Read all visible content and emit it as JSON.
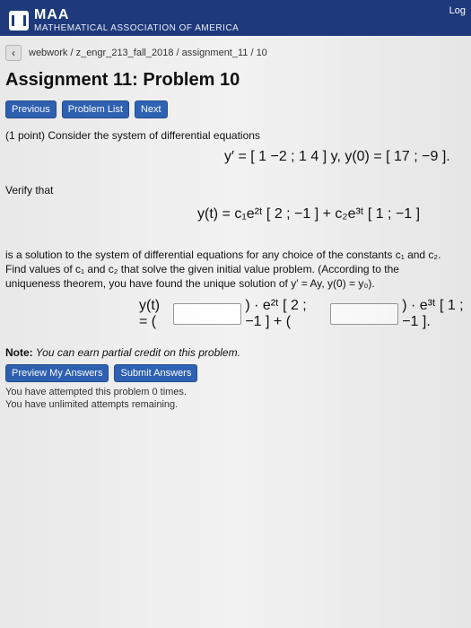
{
  "app": {
    "logo_text": "MAA",
    "logo_sub": "MATHEMATICAL ASSOCIATION OF AMERICA",
    "login": "Log"
  },
  "breadcrumb": {
    "path": "webwork / z_engr_213_fall_2018 / assignment_11 / 10"
  },
  "assignment": {
    "title": "Assignment 11: Problem 10",
    "nav": [
      "Previous",
      "Problem List",
      "Next"
    ]
  },
  "problem": {
    "intro": "(1 point) Consider the system of differential equations",
    "verify": "Verify that",
    "system_eq_text": "y′ = [ 1  −2 ; 1  4 ] y,  y(0) = [ 17 ; −9 ].",
    "general_sol_text": "y(t) = c₁e²ᵗ [ 2 ; −1 ] + c₂e³ᵗ [ 1 ; −1 ]",
    "explanation": "is a solution to the system of differential equations for any choice of the constants c₁ and c₂. Find values of c₁ and c₂ that solve the given initial value problem. (According to the uniqueness theorem, you have found the unique solution of y′ = Ay, y(0) = y₀).",
    "answer_prefix": "y(t) = (",
    "answer_mid": ") · e²ᵗ [ 2 ; −1 ] + (",
    "answer_suffix": ") · e³ᵗ [ 1 ; −1 ]."
  },
  "note": {
    "label": "Note:",
    "text": "You can earn partial credit on this problem."
  },
  "actions": [
    "Preview My Answers",
    "Submit Answers"
  ],
  "status": [
    "You have attempted this problem 0 times.",
    "You have unlimited attempts remaining."
  ]
}
